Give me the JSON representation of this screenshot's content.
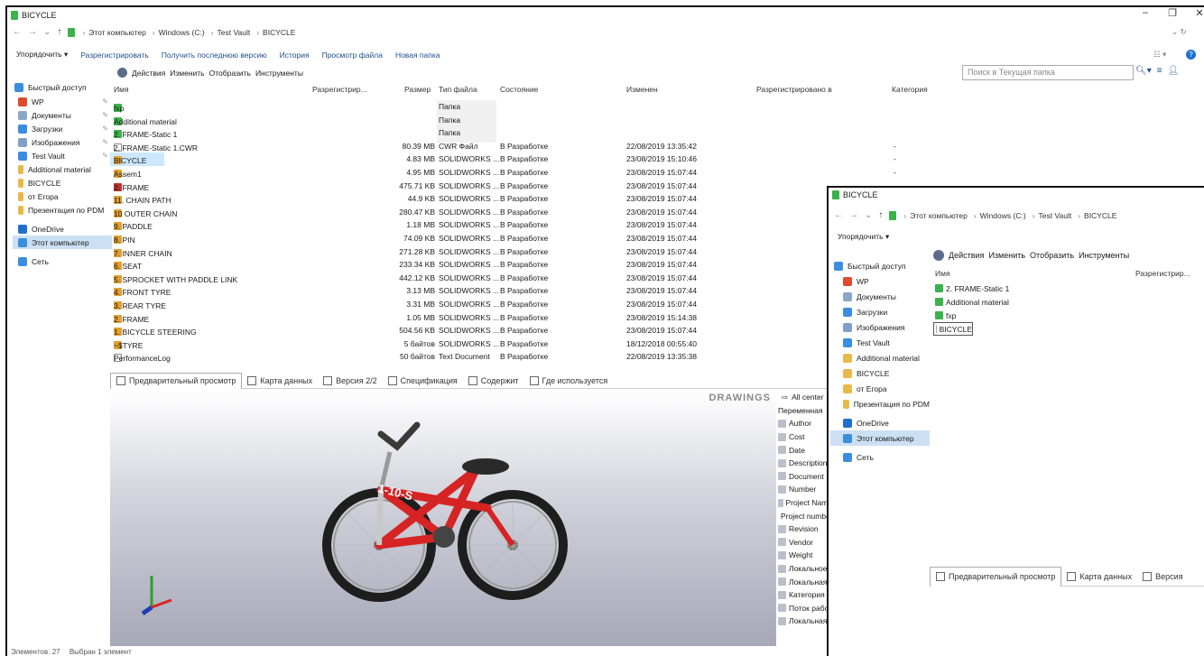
{
  "window1": {
    "title": "BICYCLE",
    "controls": [
      "–",
      "❐",
      "✕"
    ],
    "breadcrumb": [
      "Этот компьютер",
      "Windows (C:)",
      "Test Vault",
      "BICYCLE"
    ],
    "address_right": "⌄ ↻",
    "toolbar": [
      "Упорядочить ▾",
      "Разрегистрировать",
      "Получить последнюю версию",
      "История",
      "Просмотр файла",
      "Новая папка"
    ],
    "menu": [
      "Действия",
      "Изменить",
      "Отобразить",
      "Инструменты"
    ],
    "search_placeholder": "Поиск в Текущая папка",
    "nav": [
      {
        "label": "Быстрый доступ",
        "icon": "star-icon",
        "color": "#3b8de0"
      },
      {
        "label": "WP",
        "icon": "app-icon",
        "color": "#e04a2a",
        "pin": true
      },
      {
        "label": "Документы",
        "icon": "documents-icon",
        "color": "#8aa6c8",
        "pin": true
      },
      {
        "label": "Загрузки",
        "icon": "download-icon",
        "color": "#3b8de0",
        "pin": true
      },
      {
        "label": "Изображения",
        "icon": "pictures-icon",
        "color": "#7fa0c8",
        "pin": true
      },
      {
        "label": "Test Vault",
        "icon": "vault-icon",
        "color": "#3b8de0",
        "pin": true
      },
      {
        "label": "Additional material",
        "icon": "folder-icon",
        "color": "#e8b84a"
      },
      {
        "label": "BICYCLE",
        "icon": "folder-icon",
        "color": "#e8b84a"
      },
      {
        "label": "от Егора",
        "icon": "folder-icon",
        "color": "#e8b84a"
      },
      {
        "label": "Презентация по PDM",
        "icon": "folder-icon",
        "color": "#e8b84a"
      },
      {
        "label": "OneDrive",
        "icon": "cloud-icon",
        "color": "#1f6fd0"
      },
      {
        "label": "Этот компьютер",
        "icon": "computer-icon",
        "color": "#3b8de0",
        "selected": true
      },
      {
        "label": "Сеть",
        "icon": "network-icon",
        "color": "#3b8de0"
      }
    ],
    "columns": [
      "Имя",
      "Разрегистрир...",
      "Размер",
      "Тип файла",
      "Состояние",
      "Изменен",
      "Разрегистрировано в",
      "Категория"
    ],
    "files": [
      {
        "name": "fxp",
        "icon": "vault",
        "size": "",
        "type": "Папка",
        "state": "",
        "modified": "",
        "cat": ""
      },
      {
        "name": "Additional material",
        "icon": "vault",
        "size": "",
        "type": "Папка",
        "state": "",
        "modified": "",
        "cat": ""
      },
      {
        "name": "2. FRAME-Static 1",
        "icon": "vault",
        "size": "",
        "type": "Папка",
        "state": "",
        "modified": "",
        "cat": ""
      },
      {
        "name": "2. FRAME-Static 1.CWR",
        "icon": "doc",
        "size": "80.39 MB",
        "type": "CWR Файл",
        "state": "В Разработке",
        "modified": "22/08/2019 13:35:42",
        "cat": "-"
      },
      {
        "name": "BICYCLE",
        "icon": "asm",
        "size": "4.83 MB",
        "type": "SOLIDWORKS ...",
        "state": "В Разработке",
        "modified": "23/08/2019 15:10:46",
        "cat": "-",
        "selected": true
      },
      {
        "name": "Assem1",
        "icon": "asm",
        "size": "4.95 MB",
        "type": "SOLIDWORKS ...",
        "state": "В Разработке",
        "modified": "23/08/2019 15:07:44",
        "cat": "-"
      },
      {
        "name": "2. FRAME",
        "icon": "drw",
        "size": "475.71 KB",
        "type": "SOLIDWORKS ...",
        "state": "В Разработке",
        "modified": "23/08/2019 15:07:44",
        "cat": "-"
      },
      {
        "name": "11. CHAIN PATH",
        "icon": "part",
        "size": "44.9 KB",
        "type": "SOLIDWORKS ...",
        "state": "В Разработке",
        "modified": "23/08/2019 15:07:44",
        "cat": ""
      },
      {
        "name": "10 OUTER CHAIN",
        "icon": "part",
        "size": "280.47 KB",
        "type": "SOLIDWORKS ...",
        "state": "В Разработке",
        "modified": "23/08/2019 15:07:44",
        "cat": ""
      },
      {
        "name": "9. PADDLE",
        "icon": "part",
        "size": "1.18 MB",
        "type": "SOLIDWORKS ...",
        "state": "В Разработке",
        "modified": "23/08/2019 15:07:44",
        "cat": ""
      },
      {
        "name": "8. PIN",
        "icon": "part",
        "size": "74.09 KB",
        "type": "SOLIDWORKS ...",
        "state": "В Разработке",
        "modified": "23/08/2019 15:07:44",
        "cat": ""
      },
      {
        "name": "7. INNER CHAIN",
        "icon": "part",
        "size": "271.28 KB",
        "type": "SOLIDWORKS ...",
        "state": "В Разработке",
        "modified": "23/08/2019 15:07:44",
        "cat": ""
      },
      {
        "name": "6. SEAT",
        "icon": "part",
        "size": "233.34 KB",
        "type": "SOLIDWORKS ...",
        "state": "В Разработке",
        "modified": "23/08/2019 15:07:44",
        "cat": ""
      },
      {
        "name": "5. SPROCKET WITH PADDLE LINK",
        "icon": "part",
        "size": "442.12 KB",
        "type": "SOLIDWORKS ...",
        "state": "В Разработке",
        "modified": "23/08/2019 15:07:44",
        "cat": ""
      },
      {
        "name": "4. FRONT TYRE",
        "icon": "part",
        "size": "3.13 MB",
        "type": "SOLIDWORKS ...",
        "state": "В Разработке",
        "modified": "23/08/2019 15:07:44",
        "cat": ""
      },
      {
        "name": "3. REAR TYRE",
        "icon": "part",
        "size": "3.31 MB",
        "type": "SOLIDWORKS ...",
        "state": "В Разработке",
        "modified": "23/08/2019 15:07:44",
        "cat": ""
      },
      {
        "name": "2. FRAME",
        "icon": "part",
        "size": "1.05 MB",
        "type": "SOLIDWORKS ...",
        "state": "В Разработке",
        "modified": "23/08/2019 15:14:38",
        "cat": ""
      },
      {
        "name": "1. BICYCLE STEERING",
        "icon": "part",
        "size": "504.56 KB",
        "type": "SOLIDWORKS ...",
        "state": "В Разработке",
        "modified": "23/08/2019 15:07:44",
        "cat": ""
      },
      {
        "name": "~$TYRE",
        "icon": "part",
        "size": "5 байтов",
        "type": "SOLIDWORKS ...",
        "state": "В Разработке",
        "modified": "18/12/2018 00:55:40",
        "cat": ""
      },
      {
        "name": "PerformanceLog",
        "icon": "doc",
        "size": "50 байтов",
        "type": "Text Document",
        "state": "В Разработке",
        "modified": "22/08/2019 13:35:38",
        "cat": ""
      }
    ],
    "preview_tabs": [
      "Предварительный просмотр",
      "Карта данных",
      "Версия 2/2",
      "Спецификация",
      "Содержит",
      "Где используется"
    ],
    "drawings_label": "DRAWINGS",
    "frame_text": "1-10-S",
    "prop_header": "All center",
    "prop_col": "Переменная",
    "props": [
      "Author",
      "Cost",
      "Date",
      "Description",
      "Document",
      "Number",
      "Project Name",
      "Project number",
      "Revision",
      "Vendor",
      "Weight",
      "Локальное",
      "Локальная",
      "Категория",
      "Поток работ",
      "Локальная"
    ],
    "status_left": "Элементов: 27",
    "status_right": "Выбран 1 элемент"
  },
  "window2": {
    "title": "BICYCLE",
    "breadcrumb": [
      "Этот компьютер",
      "Windows (C:)",
      "Test Vault",
      "BICYCLE"
    ],
    "toolbar": "Упорядочить ▾",
    "menu": [
      "Действия",
      "Изменить",
      "Отобразить",
      "Инструменты"
    ],
    "nav": [
      {
        "label": "Быстрый доступ",
        "color": "#3b8de0"
      },
      {
        "label": "WP",
        "color": "#e04a2a"
      },
      {
        "label": "Документы",
        "color": "#8aa6c8"
      },
      {
        "label": "Загрузки",
        "color": "#3b8de0"
      },
      {
        "label": "Изображения",
        "color": "#7fa0c8"
      },
      {
        "label": "Test Vault",
        "color": "#3b8de0"
      },
      {
        "label": "Additional material",
        "color": "#e8b84a"
      },
      {
        "label": "BICYCLE",
        "color": "#e8b84a"
      },
      {
        "label": "от Егора",
        "color": "#e8b84a"
      },
      {
        "label": "Презентация по PDM",
        "color": "#e8b84a"
      },
      {
        "label": "OneDrive",
        "color": "#1f6fd0"
      },
      {
        "label": "Этот компьютер",
        "color": "#3b8de0",
        "selected": true
      },
      {
        "label": "Сеть",
        "color": "#3b8de0"
      }
    ],
    "columns": [
      "Имя",
      "Разрегистрир..."
    ],
    "files": [
      "2. FRAME-Static 1",
      "Additional material",
      "fxp",
      "BICYCLE"
    ],
    "preview_tabs": [
      "Предварительный просмотр",
      "Карта данных",
      "Версия"
    ]
  }
}
